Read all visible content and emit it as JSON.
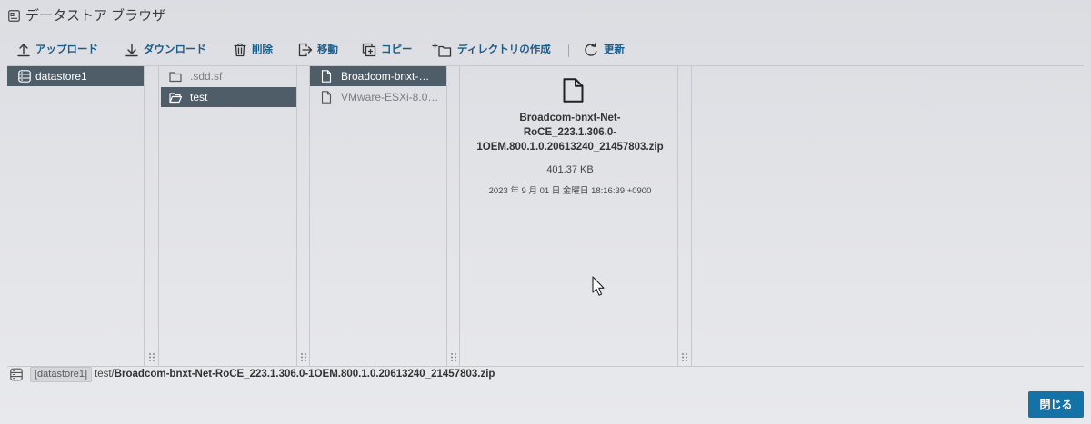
{
  "window": {
    "title": "データストア ブラウザ",
    "icon": "datastore-browser-icon"
  },
  "toolbar": {
    "items": [
      {
        "label": "アップロード",
        "icon": "upload-icon"
      },
      {
        "label": "ダウンロード",
        "icon": "download-icon"
      },
      {
        "label": "削除",
        "icon": "trash-icon"
      },
      {
        "label": "移動",
        "icon": "move-icon"
      },
      {
        "label": "コピー",
        "icon": "copy-icon"
      },
      {
        "label": "ディレクトリの作成",
        "icon": "new-folder-icon"
      },
      {
        "label": "更新",
        "icon": "refresh-icon"
      }
    ]
  },
  "columns": [
    {
      "items": [
        {
          "name": "datastore1",
          "icon": "datastore-icon",
          "selected": true
        }
      ]
    },
    {
      "items": [
        {
          "name": ".sdd.sf",
          "icon": "folder-icon",
          "selected": false
        },
        {
          "name": "test",
          "icon": "folder-open-icon",
          "selected": true
        }
      ]
    },
    {
      "items": [
        {
          "name": "Broadcom-bnxt-…",
          "icon": "file-icon",
          "selected": true
        },
        {
          "name": "VMware-ESXi-8.0…",
          "icon": "file-icon",
          "selected": false
        }
      ]
    }
  ],
  "preview": {
    "icon": "file-icon",
    "name_lines": [
      "Broadcom-bnxt-Net-",
      "RoCE_223.1.306.0-",
      "1OEM.800.1.0.20613240_21457803.zip"
    ],
    "size": "401.37 KB",
    "modified": "2023 年 9 月 01 日 金曜日 18:16:39 +0900"
  },
  "path_bar": {
    "icon": "datastore-icon",
    "datastore": "[datastore1]",
    "folder": "test/",
    "file": "Broadcom-bnxt-Net-RoCE_223.1.306.0-1OEM.800.1.0.20613240_21457803.zip"
  },
  "footer": {
    "close_label": "閉じる"
  },
  "colors": {
    "accent": "#1472a6",
    "selected_row": "#4f5d69",
    "toolbar_text": "#1a5c88"
  }
}
